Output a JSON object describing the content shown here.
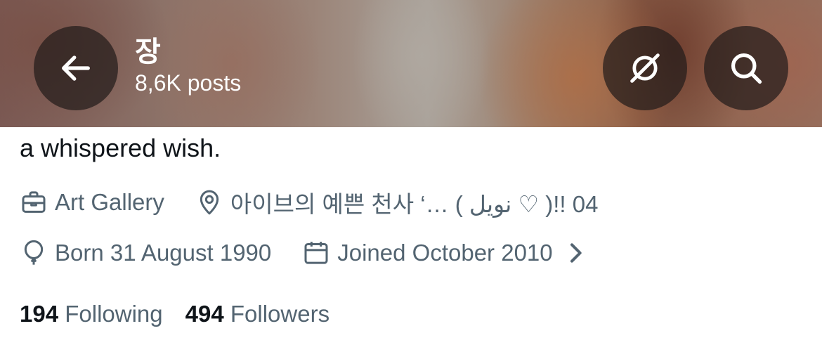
{
  "header": {
    "name": "장",
    "posts": "8,6K posts"
  },
  "icons": {
    "back": "arrow-left-icon",
    "grok": "grok-icon",
    "search": "search-icon"
  },
  "profile": {
    "bio": "a whispered wish.",
    "category": "Art Gallery",
    "location": "아이브의 예쁜 천사 ‘… ( نويل ♡ )!! 04",
    "birthday": "Born 31 August 1990",
    "joined": "Joined October 2010"
  },
  "stats": {
    "following_count": "194",
    "following_label": "Following",
    "followers_count": "494",
    "followers_label": "Followers"
  },
  "colors": {
    "text_primary": "#0f1419",
    "text_secondary": "#536471",
    "button_overlay": "#231c1a"
  }
}
